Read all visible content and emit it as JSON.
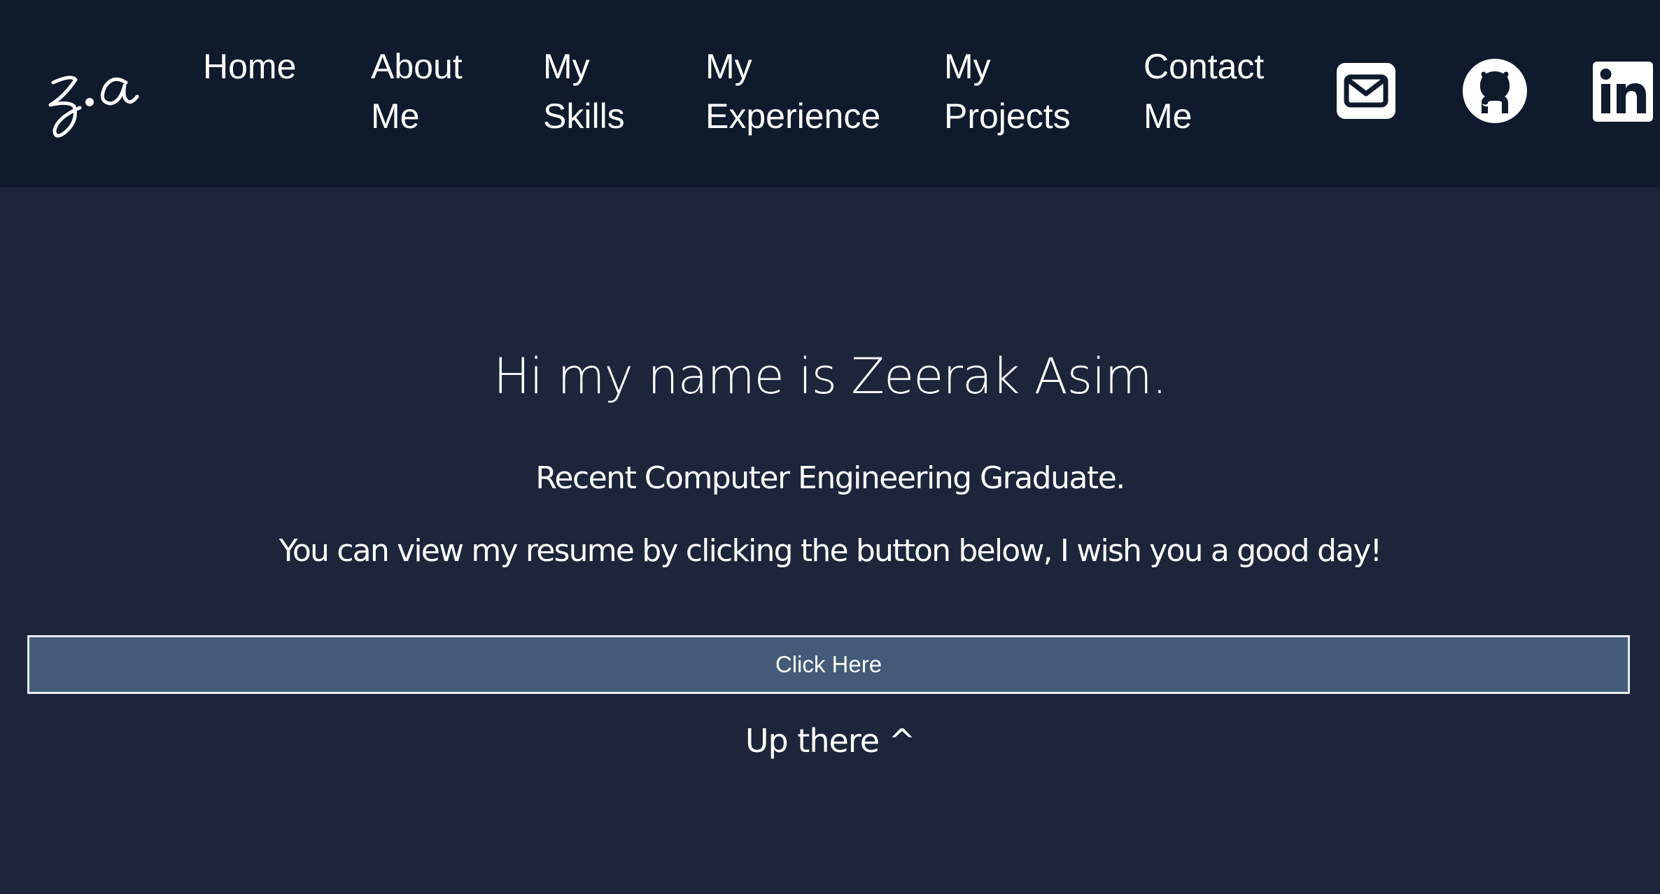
{
  "brand": {
    "logo_text": "z.a",
    "logo_icon": "signature-logo-icon"
  },
  "nav": {
    "items": [
      {
        "line1": "Home",
        "line2": ""
      },
      {
        "line1": "About",
        "line2": "Me"
      },
      {
        "line1": "My",
        "line2": "Skills"
      },
      {
        "line1": "My",
        "line2": "Experience"
      },
      {
        "line1": "My",
        "line2": "Projects"
      },
      {
        "line1": "Contact",
        "line2": "Me"
      }
    ],
    "social": [
      {
        "name": "email",
        "icon": "mail-icon"
      },
      {
        "name": "github",
        "icon": "github-icon"
      },
      {
        "name": "linkedin",
        "icon": "linkedin-icon"
      }
    ]
  },
  "hero": {
    "title": "Hi my name is Zeerak Asim.",
    "subtitle": "Recent Computer Engineering Graduate.",
    "description": "You can view my resume by clicking the button below, I wish you a good day!",
    "button_label": "Click Here",
    "note": "Up there ^"
  },
  "colors": {
    "nav_background": "#0f1a2c",
    "page_background": "#1c253a",
    "button_background": "#435b78",
    "text": "#ffffff"
  }
}
